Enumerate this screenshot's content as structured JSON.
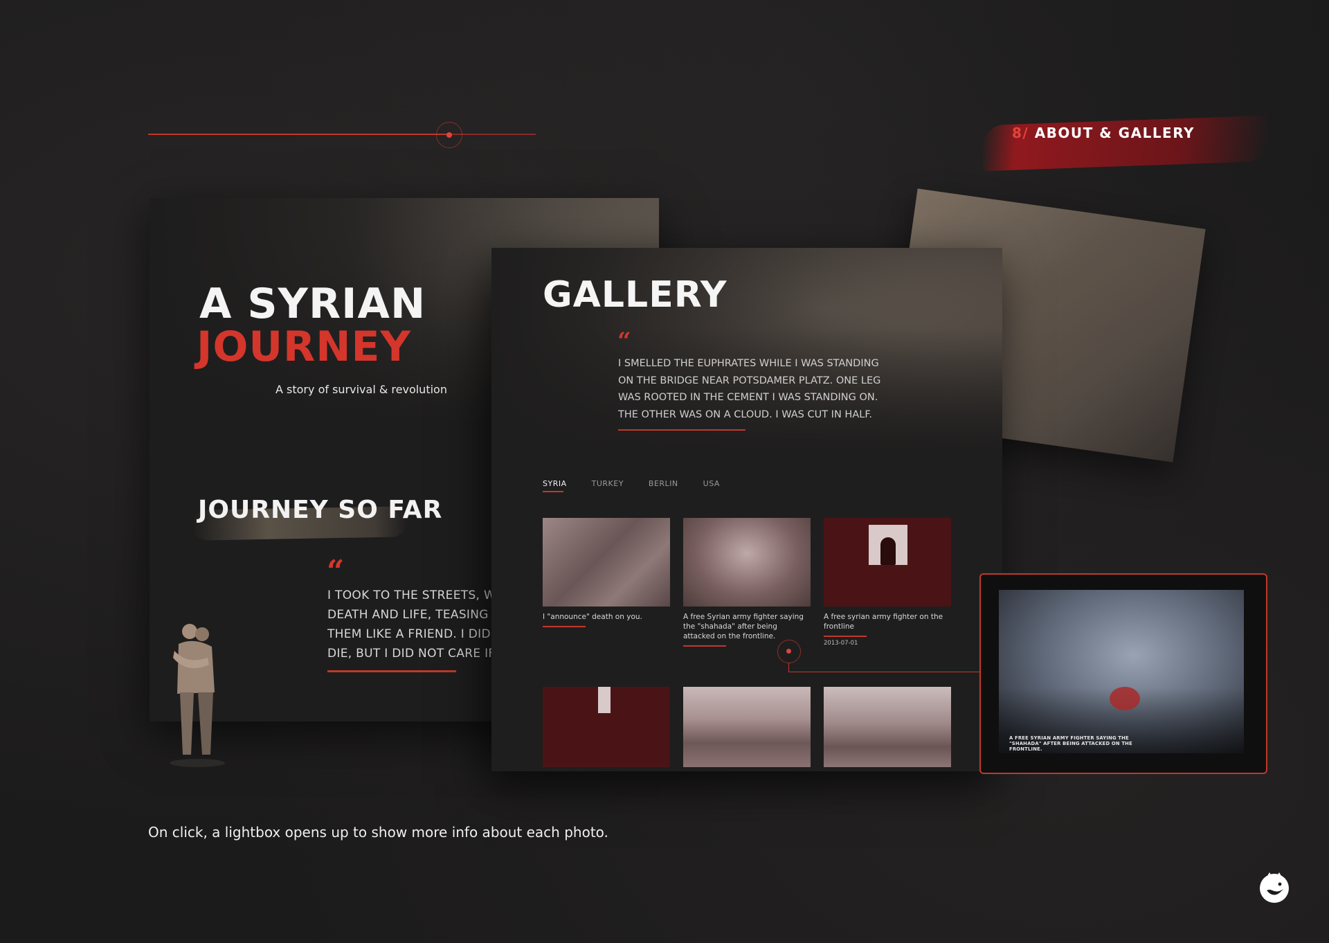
{
  "section": {
    "number": "8/",
    "title": "ABOUT & GALLERY"
  },
  "progress": {
    "value": 0.78
  },
  "left_screen": {
    "title_line1": "A SYRIAN",
    "title_line2": "JOURNEY",
    "subtitle": "A story of survival & revolution",
    "section_heading": "JOURNEY SO FAR",
    "quote_mark": "“",
    "quote_lines": [
      "I TOOK TO THE STREETS, WA",
      "DEATH AND LIFE, TEASING BO",
      "THEM LIKE A FRIEND. I DID N",
      "DIE, BUT I DID NOT CARE IF I"
    ]
  },
  "gallery_screen": {
    "title": "GALLERY",
    "quote_mark": "“",
    "quote_lines": [
      "I SMELLED THE EUPHRATES WHILE I WAS STANDING",
      "ON THE BRIDGE NEAR POTSDAMER PLATZ. ONE LEG",
      "WAS ROOTED IN THE CEMENT I WAS STANDING ON.",
      "THE OTHER WAS ON A CLOUD. I WAS CUT IN HALF."
    ],
    "tabs": [
      "SYRIA",
      "TURKEY",
      "BERLIN",
      "USA"
    ],
    "active_tab": "SYRIA",
    "photos": [
      {
        "caption": "I \"announce\" death on you."
      },
      {
        "caption": "A free Syrian army fighter saying the \"shahada\" after being attacked on the frontline."
      },
      {
        "caption": "A free syrian army fighter on the frontline",
        "date": "2013-07-01"
      }
    ]
  },
  "lightbox": {
    "caption": "A FREE SYRIAN ARMY FIGHTER SAYING THE \"SHAHADA\" AFTER BEING ATTACKED ON THE FRONTLINE."
  },
  "footer_note": "On click, a lightbox opens up to show more info about each photo.",
  "colors": {
    "accent": "#d4362c",
    "background": "#1c1b1b"
  },
  "icons": {
    "brand_logo": "fox-logo-icon"
  }
}
